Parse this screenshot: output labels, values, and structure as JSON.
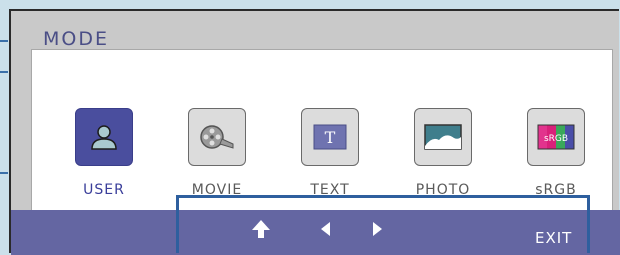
{
  "menu": {
    "title": "MODE",
    "modes": [
      {
        "label": "USER",
        "icon": "user-icon",
        "selected": true
      },
      {
        "label": "MOVIE",
        "icon": "film-reel-icon",
        "selected": false
      },
      {
        "label": "TEXT",
        "icon": "text-t-icon",
        "selected": false
      },
      {
        "label": "PHOTO",
        "icon": "landscape-photo-icon",
        "selected": false
      },
      {
        "label": "sRGB",
        "icon": "srgb-color-bars-icon",
        "selected": false,
        "icon_text": "sRGB"
      }
    ]
  },
  "controls": {
    "up": "up-arrow-icon",
    "left": "left-arrow-icon",
    "right": "right-arrow-icon",
    "exit_label": "EXIT"
  },
  "colors": {
    "title": "#4a4e86",
    "selected_tile": "#4a4e9e",
    "bottom_bar": "#6466a2",
    "highlight_border": "#2e5f9e"
  }
}
